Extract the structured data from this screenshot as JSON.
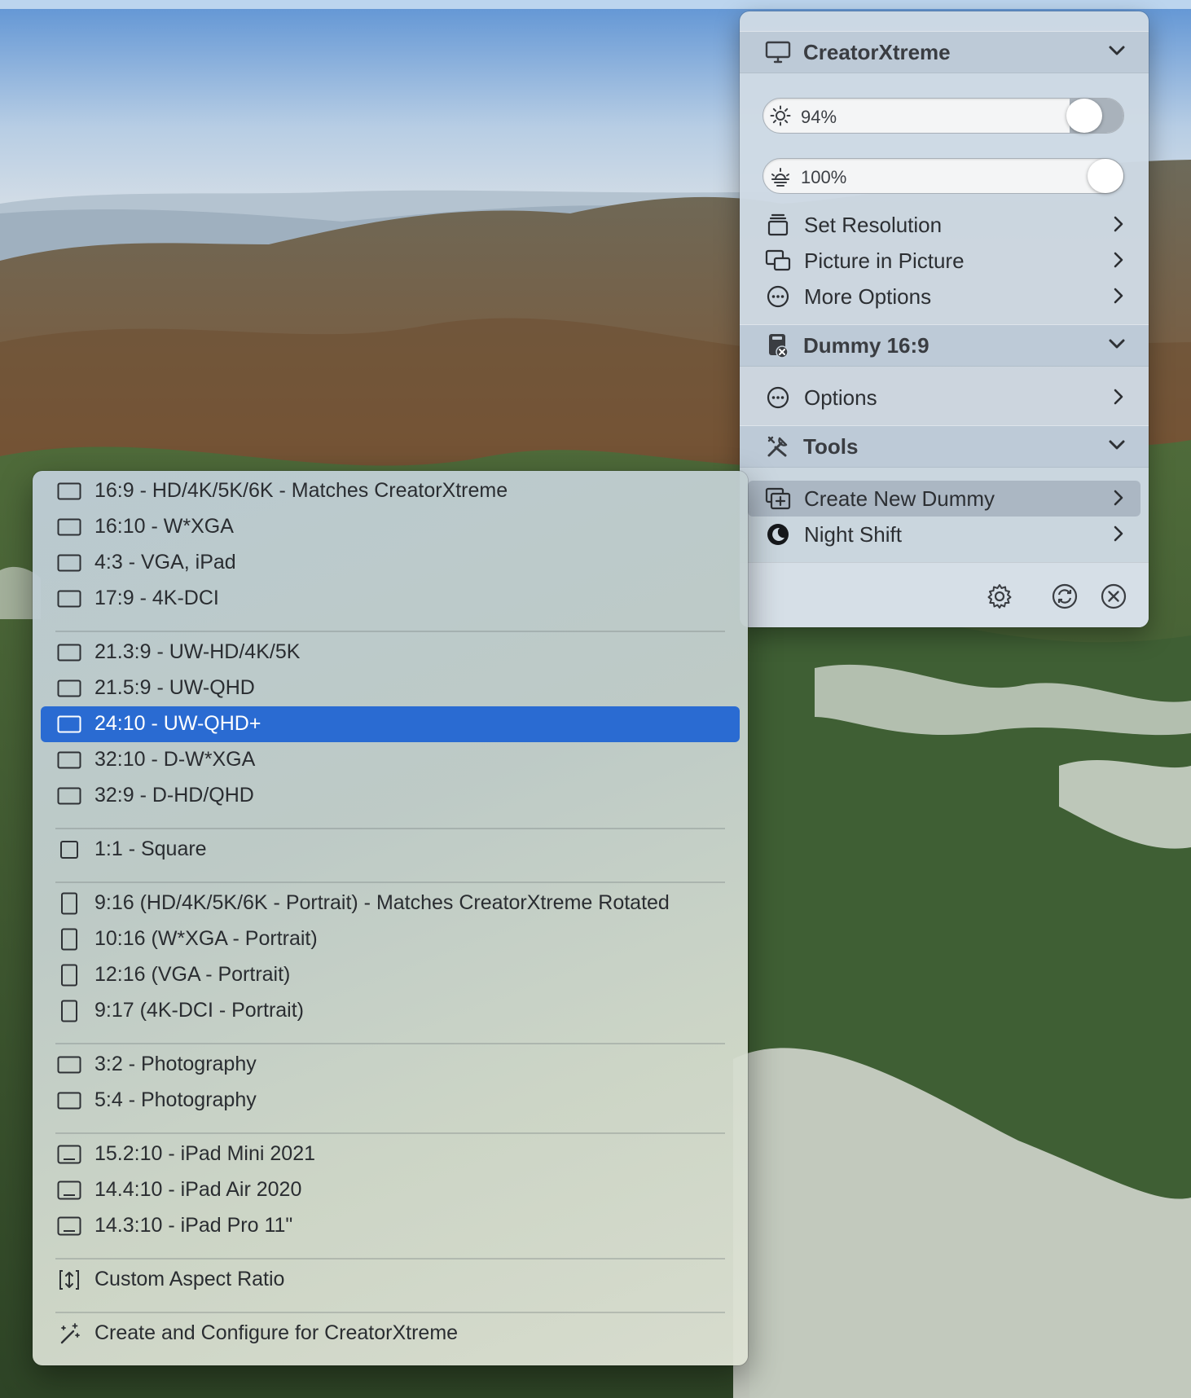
{
  "main_menu": {
    "display_header": {
      "title": "CreatorXtreme",
      "icon": "monitor-icon"
    },
    "brightness_slider": {
      "value": "94%",
      "level": 0.94,
      "icon": "sun-icon"
    },
    "color_slider": {
      "value": "100%",
      "level": 1.0,
      "icon": "sunrise-icon"
    },
    "display_items": [
      {
        "label": "Set Resolution",
        "icon": "resolution-stack-icon"
      },
      {
        "label": "Picture in Picture",
        "icon": "picture-in-picture-icon"
      },
      {
        "label": "More Options",
        "icon": "ellipsis-circle-icon"
      }
    ],
    "dummy_header": {
      "title": "Dummy 16:9",
      "icon": "dummy-display-icon"
    },
    "dummy_items": [
      {
        "label": "Options",
        "icon": "ellipsis-circle-icon"
      }
    ],
    "tools_header": {
      "title": "Tools",
      "icon": "tools-icon"
    },
    "tools_items": [
      {
        "label": "Create New Dummy",
        "icon": "add-display-icon",
        "highlighted": true
      },
      {
        "label": "Night Shift",
        "icon": "moon-icon"
      }
    ],
    "footer_icons": [
      "gear-icon",
      "refresh-icon",
      "close-circle-icon"
    ]
  },
  "submenu": {
    "selected_index": 6,
    "items": [
      {
        "label": "16:9 - HD/4K/5K/6K - Matches CreatorXtreme",
        "icon": "landscape-rect-icon"
      },
      {
        "label": "16:10 - W*XGA",
        "icon": "landscape-rect-icon"
      },
      {
        "label": "4:3 - VGA, iPad",
        "icon": "landscape-rect-icon"
      },
      {
        "label": "17:9 - 4K-DCI",
        "icon": "landscape-rect-icon"
      },
      {
        "label": "21.3:9 - UW-HD/4K/5K",
        "icon": "landscape-rect-icon"
      },
      {
        "label": "21.5:9 - UW-QHD",
        "icon": "landscape-rect-icon"
      },
      {
        "label": "24:10 - UW-QHD+",
        "icon": "landscape-rect-icon"
      },
      {
        "label": "32:10 - D-W*XGA",
        "icon": "landscape-rect-icon"
      },
      {
        "label": "32:9 - D-HD/QHD",
        "icon": "landscape-rect-icon"
      },
      {
        "label": "1:1 - Square",
        "icon": "square-icon"
      },
      {
        "label": "9:16 (HD/4K/5K/6K - Portrait) - Matches CreatorXtreme Rotated",
        "icon": "portrait-rect-icon"
      },
      {
        "label": "10:16 (W*XGA - Portrait)",
        "icon": "portrait-rect-icon"
      },
      {
        "label": "12:16 (VGA - Portrait)",
        "icon": "portrait-rect-icon"
      },
      {
        "label": "9:17 (4K-DCI - Portrait)",
        "icon": "portrait-rect-icon"
      },
      {
        "label": "3:2 - Photography",
        "icon": "landscape-rect-icon"
      },
      {
        "label": "5:4 - Photography",
        "icon": "landscape-rect-icon"
      },
      {
        "label": "15.2:10 - iPad Mini 2021",
        "icon": "ipad-icon"
      },
      {
        "label": "14.4:10 - iPad Air 2020",
        "icon": "ipad-icon"
      },
      {
        "label": "14.3:10 - iPad Pro 11\"",
        "icon": "ipad-icon"
      },
      {
        "label": "Custom Aspect Ratio",
        "icon": "custom-ratio-icon"
      },
      {
        "label": "Create and Configure for CreatorXtreme",
        "icon": "magic-wand-icon"
      }
    ]
  },
  "colors": {
    "selection": "#2a6bd2",
    "menu_background": "#cedae4",
    "text": "#2a2d31"
  }
}
